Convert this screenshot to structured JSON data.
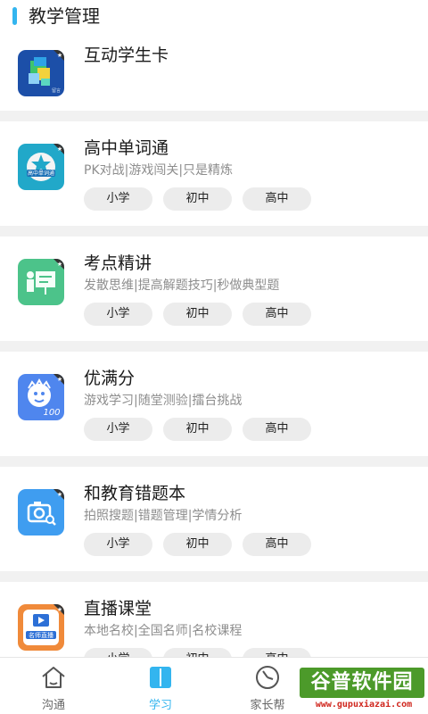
{
  "section": {
    "title": "教学管理"
  },
  "cards": [
    {
      "title": "互动学生卡",
      "icon": "student-card-icon"
    },
    {
      "title": "高中单词通",
      "subtitle": "PK对战|游戏闯关|只是精炼",
      "icon": "word-book-icon",
      "levels": [
        "小学",
        "初中",
        "高中"
      ]
    },
    {
      "title": "考点精讲",
      "subtitle": "发散思维|提高解题技巧|秒做典型题",
      "icon": "teacher-board-icon",
      "levels": [
        "小学",
        "初中",
        "高中"
      ]
    },
    {
      "title": "优满分",
      "subtitle": "游戏学习|随堂测验|擂台挑战",
      "icon": "score-100-icon",
      "levels": [
        "小学",
        "初中",
        "高中"
      ]
    },
    {
      "title": "和教育错题本",
      "subtitle": "拍照搜题|错题管理|学情分析",
      "icon": "camera-search-icon",
      "levels": [
        "小学",
        "初中",
        "高中"
      ]
    },
    {
      "title": "直播课堂",
      "subtitle": "本地名校|全国名师|名校课程",
      "icon": "live-class-icon",
      "icon_text": "名师直播",
      "levels": [
        "小学",
        "初中",
        "高中"
      ]
    }
  ],
  "tabbar": {
    "items": [
      {
        "label": "沟通",
        "icon": "home-icon"
      },
      {
        "label": "学习",
        "icon": "book-icon",
        "active": true
      },
      {
        "label": "家长帮",
        "icon": "dial-icon"
      }
    ]
  },
  "watermark": {
    "text": "谷普软件园",
    "url": "www.gupuxiazai.com"
  },
  "colors": {
    "accent": "#33b5ef",
    "pill": "#ececec",
    "separator": "#f1f1f1"
  }
}
